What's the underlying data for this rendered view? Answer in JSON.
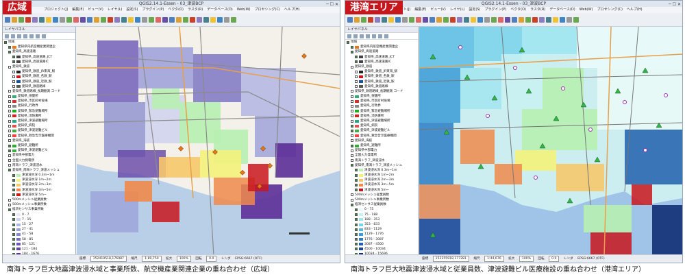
{
  "left": {
    "badge": "広域",
    "window_title": "QGIS2.14.1-Essen - 03_津波BCP",
    "menu": [
      "プロジェクト(J)",
      "編集(E)",
      "ビュー(V)",
      "レイヤ(L)",
      "設定(S)",
      "プラグイン(P)",
      "ベクタ(O)",
      "ラスタ(R)",
      "データベース(D)",
      "Web(W)",
      "プロセシング(C)",
      "ヘルプ(H)"
    ],
    "layers_title": "レイヤパネル",
    "layers": [
      {
        "label": "地域",
        "checked": true,
        "indent": 0,
        "sym": ""
      },
      {
        "label": "愛知県内航空機産業関連企",
        "checked": true,
        "indent": 1,
        "sym": "#e07a1d"
      },
      {
        "label": "愛知県_高速道路",
        "checked": true,
        "indent": 1,
        "sym": ""
      },
      {
        "label": "愛知県_高速道路_JCT",
        "checked": true,
        "indent": 2,
        "sym": "#444"
      },
      {
        "label": "愛知県_高速道路IC",
        "checked": true,
        "indent": 2,
        "sym": "#444"
      },
      {
        "label": "愛知県_鉄道",
        "checked": false,
        "indent": 1,
        "sym": ""
      },
      {
        "label": "愛知県_鉄道_JR東海_駅",
        "checked": false,
        "indent": 2,
        "sym": "#222"
      },
      {
        "label": "愛知県_鉄道_名鉄_駅",
        "checked": false,
        "indent": 2,
        "sym": "#c8161d"
      },
      {
        "label": "愛知県_鉄道_近鉄_駅",
        "checked": false,
        "indent": 2,
        "sym": "#1d4fa0"
      },
      {
        "label": "愛知県_鉄道路線",
        "checked": false,
        "indent": 2,
        "sym": "#555"
      },
      {
        "label": "愛知県_鉄道路線_長期観測 コード",
        "checked": false,
        "indent": 1,
        "sym": ""
      },
      {
        "label": "愛知県_保健所",
        "checked": false,
        "indent": 1,
        "sym": "#3a7"
      },
      {
        "label": "愛知県_市区町村役場",
        "checked": false,
        "indent": 1,
        "sym": "#c33"
      },
      {
        "label": "愛知県_行政界",
        "checked": false,
        "indent": 1,
        "sym": "#888"
      },
      {
        "label": "愛知県_緊急避難場所",
        "checked": false,
        "indent": 1,
        "sym": "#2a2"
      },
      {
        "label": "愛知県_消防署所",
        "checked": false,
        "indent": 1,
        "sym": "#d22"
      },
      {
        "label": "愛知県_津波避難場所",
        "checked": false,
        "indent": 1,
        "sym": "#2a8"
      },
      {
        "label": "愛知県_病院",
        "checked": false,
        "indent": 1,
        "sym": "#d55"
      },
      {
        "label": "愛知県_津波避難ビル",
        "checked": false,
        "indent": 1,
        "sym": "#4a4"
      },
      {
        "label": "愛知県_救急告示医療機関",
        "checked": false,
        "indent": 1,
        "sym": "#e44"
      },
      {
        "label": "愛知県_海抜 ",
        "checked": false,
        "indent": 1,
        "sym": ""
      },
      {
        "label": "愛知県_避難所",
        "checked": true,
        "indent": 1,
        "sym": "#3a3"
      },
      {
        "label": "愛知県_津波避難ビル",
        "checked": true,
        "indent": 1,
        "sym": "#4a4"
      },
      {
        "label": "愛知県中部電力",
        "checked": false,
        "indent": 1,
        "sym": ""
      },
      {
        "label": "全国火力発電所",
        "checked": false,
        "indent": 1,
        "sym": ""
      },
      {
        "label": "南海トラフ_津波浸水",
        "checked": false,
        "indent": 1,
        "sym": ""
      },
      {
        "label": "愛知県_南海トラフ_津波メッシュ",
        "checked": true,
        "indent": 1,
        "sym": ""
      },
      {
        "label": "津波浸水深 0.3m~1m",
        "checked": true,
        "indent": 2,
        "sym": "#b7f0b1"
      },
      {
        "label": "津波浸水深 1m~2m",
        "checked": true,
        "indent": 2,
        "sym": "#f4f27a"
      },
      {
        "label": "津波浸水深 2m~3m",
        "checked": true,
        "indent": 2,
        "sym": "#f6c86a"
      },
      {
        "label": "津波浸水深 3m~5m",
        "checked": true,
        "indent": 2,
        "sym": "#f08a4b"
      },
      {
        "label": "津波浸水深 5m~",
        "checked": true,
        "indent": 2,
        "sym": "#c8161d"
      },
      {
        "label": "500mメッシュ従業員数",
        "checked": false,
        "indent": 1,
        "sym": ""
      },
      {
        "label": "500mメッシュ事業所数",
        "checked": false,
        "indent": 1,
        "sym": ""
      },
      {
        "label": "経済センサス事業所数",
        "checked": true,
        "indent": 1,
        "sym": ""
      },
      {
        "label": "0 - 7",
        "checked": true,
        "indent": 2,
        "sym": "#e8e8f7"
      },
      {
        "label": "7 - 15",
        "checked": true,
        "indent": 2,
        "sym": "#cfd2ee"
      },
      {
        "label": "15 - 27",
        "checked": true,
        "indent": 2,
        "sym": "#b2b6e2"
      },
      {
        "label": "27 - 41",
        "checked": true,
        "indent": 2,
        "sym": "#9a9fd8"
      },
      {
        "label": "41 - 58",
        "checked": true,
        "indent": 2,
        "sym": "#8588cc"
      },
      {
        "label": "58 - 85",
        "checked": true,
        "indent": 2,
        "sym": "#756fc1"
      },
      {
        "label": "85 - 121",
        "checked": true,
        "indent": 2,
        "sym": "#6a58b6"
      },
      {
        "label": "121 - 184",
        "checked": true,
        "indent": 2,
        "sym": "#6545a8"
      },
      {
        "label": "184 - 1676",
        "checked": true,
        "indent": 2,
        "sym": "#5c2e98"
      },
      {
        "label": "1676 - 1529",
        "checked": true,
        "indent": 2,
        "sym": "#4b1a85"
      },
      {
        "label": "経済センサス従業員数",
        "checked": false,
        "indent": 1,
        "sym": ""
      },
      {
        "label": "経済センサス事業所数",
        "checked": false,
        "indent": 1,
        "sym": ""
      },
      {
        "label": "南海トラフ想定震度",
        "checked": false,
        "indent": 1,
        "sym": ""
      },
      {
        "label": "基本地図",
        "checked": true,
        "indent": 0,
        "sym": ""
      }
    ],
    "status": {
      "coord_label": "座標",
      "coord_value": "152419518,176987",
      "scale_label": "縮尺",
      "scale_value": "1:89,750",
      "magnify_label": "拡大",
      "magnify_value": "100%",
      "rotation_label": "回転",
      "rotation_value": "0.0",
      "render_label": "レンダ",
      "crs": "EPSG:6667 (OTF)"
    },
    "caption": "南海トラフ巨大地震津波浸水域と事業所数、航空機産業関連企業の重ね合わせ（広域）"
  },
  "right": {
    "badge": "港湾エリア",
    "window_title": "QGIS2.14.1-Essen - 03_津波BCP",
    "menu": [
      "プロジェクト(J)",
      "編集(E)",
      "ビュー(V)",
      "レイヤ(L)",
      "設定(S)",
      "プラグイン(P)",
      "ベクタ(O)",
      "ラスタ(R)",
      "データベース(D)",
      "Web(W)",
      "プロセシング(C)",
      "ヘルプ(H)"
    ],
    "layers_title": "レイヤパネル",
    "layers": [
      {
        "label": "地域",
        "checked": true,
        "indent": 0,
        "sym": ""
      },
      {
        "label": "愛知県内航空機産業関連企",
        "checked": true,
        "indent": 1,
        "sym": "#e07a1d"
      },
      {
        "label": "愛知県_高速道路",
        "checked": true,
        "indent": 1,
        "sym": ""
      },
      {
        "label": "愛知県_高速道路_JCT",
        "checked": true,
        "indent": 2,
        "sym": "#444"
      },
      {
        "label": "愛知県_高速道路IC",
        "checked": true,
        "indent": 2,
        "sym": "#444"
      },
      {
        "label": "愛知県_鉄道",
        "checked": false,
        "indent": 1,
        "sym": ""
      },
      {
        "label": "愛知県_鉄道_JR東海_駅",
        "checked": false,
        "indent": 2,
        "sym": "#222"
      },
      {
        "label": "愛知県_鉄道_名鉄_駅",
        "checked": false,
        "indent": 2,
        "sym": "#c8161d"
      },
      {
        "label": "愛知県_鉄道_近鉄_駅",
        "checked": false,
        "indent": 2,
        "sym": "#1d4fa0"
      },
      {
        "label": "愛知県_鉄道路線",
        "checked": false,
        "indent": 2,
        "sym": "#555"
      },
      {
        "label": "愛知県_鉄道路線_長期観測 コード",
        "checked": false,
        "indent": 1,
        "sym": ""
      },
      {
        "label": "愛知県_保健所",
        "checked": false,
        "indent": 1,
        "sym": "#3a7"
      },
      {
        "label": "愛知県_市区町村役場",
        "checked": false,
        "indent": 1,
        "sym": "#c33"
      },
      {
        "label": "愛知県_行政界",
        "checked": false,
        "indent": 1,
        "sym": "#888"
      },
      {
        "label": "愛知県_緊急避難場所",
        "checked": false,
        "indent": 1,
        "sym": "#2a2"
      },
      {
        "label": "愛知県_消防署所",
        "checked": false,
        "indent": 1,
        "sym": "#d22"
      },
      {
        "label": "愛知県_津波避難場所",
        "checked": false,
        "indent": 1,
        "sym": "#2a8"
      },
      {
        "label": "愛知県_病院",
        "checked": true,
        "indent": 1,
        "sym": "#d55"
      },
      {
        "label": "愛知県_津波避難ビル",
        "checked": true,
        "indent": 1,
        "sym": "#4a4"
      },
      {
        "label": "愛知県_救急告示医療機関",
        "checked": false,
        "indent": 1,
        "sym": "#e44"
      },
      {
        "label": "愛知県_海抜 ",
        "checked": false,
        "indent": 1,
        "sym": ""
      },
      {
        "label": "愛知県_避難所",
        "checked": true,
        "indent": 1,
        "sym": "#3a3"
      },
      {
        "label": "愛知県中部電力",
        "checked": false,
        "indent": 1,
        "sym": ""
      },
      {
        "label": "全国火力発電所",
        "checked": false,
        "indent": 1,
        "sym": ""
      },
      {
        "label": "南海トラフ_津波浸水",
        "checked": false,
        "indent": 1,
        "sym": ""
      },
      {
        "label": "愛知県_南海トラフ_津波メッシュ",
        "checked": true,
        "indent": 1,
        "sym": ""
      },
      {
        "label": "津波浸水深 0.3m~1m",
        "checked": true,
        "indent": 2,
        "sym": "#b7f0b1"
      },
      {
        "label": "津波浸水深 1m~2m",
        "checked": true,
        "indent": 2,
        "sym": "#f4f27a"
      },
      {
        "label": "津波浸水深 2m~3m",
        "checked": true,
        "indent": 2,
        "sym": "#f6c86a"
      },
      {
        "label": "津波浸水深 3m~5m",
        "checked": true,
        "indent": 2,
        "sym": "#f08a4b"
      },
      {
        "label": "津波浸水深 5m~",
        "checked": true,
        "indent": 2,
        "sym": "#c8161d"
      },
      {
        "label": "500mメッシュ従業員数",
        "checked": false,
        "indent": 1,
        "sym": ""
      },
      {
        "label": "500mメッシュ事業所数",
        "checked": false,
        "indent": 1,
        "sym": ""
      },
      {
        "label": "経済センサス従業員数",
        "checked": true,
        "indent": 1,
        "sym": ""
      },
      {
        "label": "0 - 75",
        "checked": true,
        "indent": 2,
        "sym": "#eafaf8"
      },
      {
        "label": "75 - 188",
        "checked": true,
        "indent": 2,
        "sym": "#c9f1f2"
      },
      {
        "label": "188 - 353",
        "checked": true,
        "indent": 2,
        "sym": "#a1e5ef"
      },
      {
        "label": "353 - 833",
        "checked": true,
        "indent": 2,
        "sym": "#79d2ea"
      },
      {
        "label": "833 - 1129",
        "checked": true,
        "indent": 2,
        "sym": "#55b9e3"
      },
      {
        "label": "1129 - 1776",
        "checked": true,
        "indent": 2,
        "sym": "#3a9bd6"
      },
      {
        "label": "1776 - 3087",
        "checked": true,
        "indent": 2,
        "sym": "#2a7cc4"
      },
      {
        "label": "3087 - 4500",
        "checked": true,
        "indent": 2,
        "sym": "#1f5fad"
      },
      {
        "label": "4500 - 10034",
        "checked": true,
        "indent": 2,
        "sym": "#194695"
      },
      {
        "label": "10034 - 15696",
        "checked": true,
        "indent": 2,
        "sym": "#102e74"
      },
      {
        "label": "経済センサス事業所数",
        "checked": false,
        "indent": 1,
        "sym": ""
      },
      {
        "label": "南海トラフ想定震度",
        "checked": false,
        "indent": 1,
        "sym": ""
      },
      {
        "label": "基本地図",
        "checked": true,
        "indent": 0,
        "sym": ""
      }
    ],
    "status": {
      "coord_label": "座標",
      "coord_value": "152355918,177281",
      "scale_label": "縮尺",
      "scale_value": "1:44,676",
      "magnify_label": "拡大",
      "magnify_value": "100%",
      "rotation_label": "回転",
      "rotation_value": "0.0",
      "render_label": "レンダ",
      "crs": "EPSG:6667 (OTF)"
    },
    "caption": "南海トラフ巨大地震津波浸水域と従業員数、津波避難ビル医療施設の重ね合わせ（港湾エリア）"
  },
  "colors": {
    "badge": "#c8161d",
    "sea": "#b9cfe8",
    "land": "#f4f1ea",
    "tsunami_shallow": "#b7f0b1",
    "tsunami_mid": "#f4f27a",
    "tsunami_deep": "#f08a4b",
    "tsunami_severe": "#c8161d",
    "business_dense": "#5c2e98",
    "employee_dense": "#194695"
  }
}
